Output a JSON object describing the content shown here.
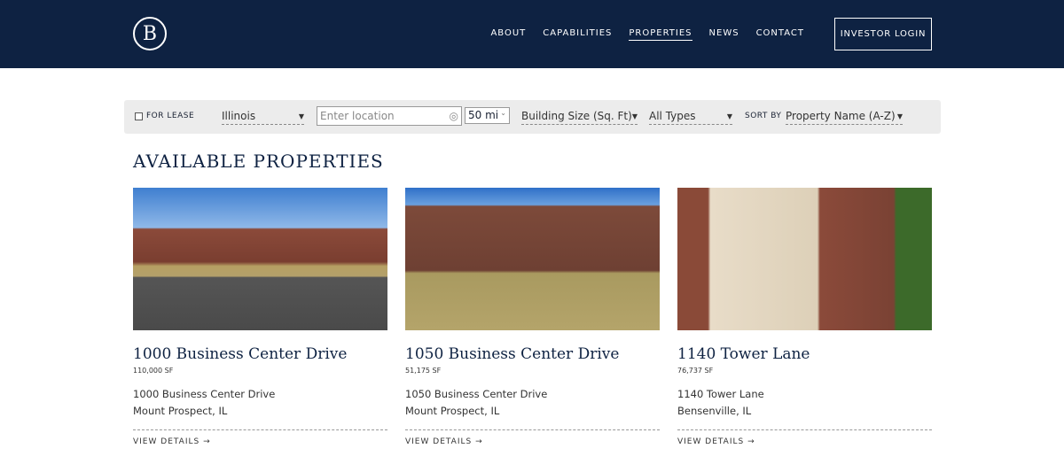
{
  "header": {
    "logo": "B",
    "nav": [
      "ABOUT",
      "CAPABILITIES",
      "PROPERTIES",
      "NEWS",
      "CONTACT"
    ],
    "active": "PROPERTIES",
    "login": "INVESTOR LOGIN"
  },
  "filters": {
    "for_lease": "FOR LEASE",
    "state": "Illinois",
    "location_placeholder": "Enter location",
    "radius": "50 mi",
    "size": "Building Size (Sq. Ft)",
    "types": "All Types",
    "sort_label": "SORT BY",
    "sort": "Property Name (A-Z)"
  },
  "heading": "AVAILABLE PROPERTIES",
  "properties": [
    {
      "title": "1000 Business Center Drive",
      "sf": "110,000 SF",
      "addr1": "1000 Business Center Drive",
      "addr2": "Mount Prospect, IL",
      "link": "VIEW DETAILS →"
    },
    {
      "title": "1050 Business Center Drive",
      "sf": "51,175 SF",
      "addr1": "1050 Business Center Drive",
      "addr2": "Mount Prospect, IL",
      "link": "VIEW DETAILS →"
    },
    {
      "title": "1140 Tower Lane",
      "sf": "76,737 SF",
      "addr1": "1140 Tower Lane",
      "addr2": "Bensenville, IL",
      "link": "VIEW DETAILS →"
    }
  ]
}
